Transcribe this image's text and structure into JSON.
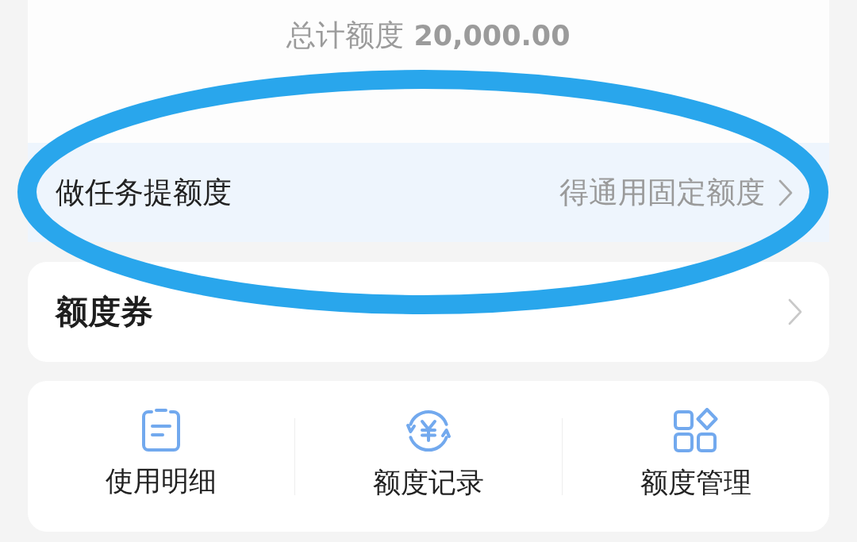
{
  "quota_card": {
    "label": "总计额度",
    "amount": "20,000.00"
  },
  "task_row": {
    "title": "做任务提额度",
    "hint": "得通用固定额度",
    "highlighted": true
  },
  "coupon_row": {
    "title": "额度券"
  },
  "shortcuts": [
    {
      "kind": "document",
      "label": "使用明细"
    },
    {
      "kind": "yuan",
      "label": "额度记录"
    },
    {
      "kind": "apps",
      "label": "额度管理"
    }
  ]
}
